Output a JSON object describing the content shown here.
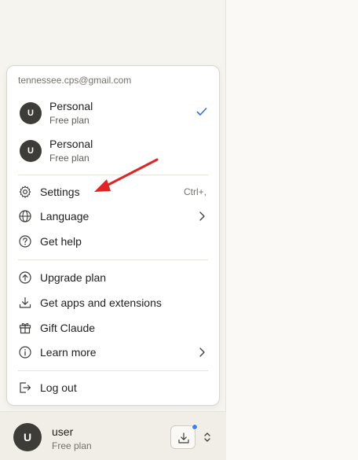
{
  "menu": {
    "email": "tennessee.cps@gmail.com",
    "accounts": [
      {
        "initial": "U",
        "name": "Personal",
        "plan": "Free plan",
        "selected": true
      },
      {
        "initial": "U",
        "name": "Personal",
        "plan": "Free plan",
        "selected": false
      }
    ],
    "items": {
      "settings": {
        "label": "Settings",
        "shortcut": "Ctrl+,",
        "icon": "gear-icon"
      },
      "language": {
        "label": "Language",
        "icon": "globe-icon"
      },
      "help": {
        "label": "Get help",
        "icon": "question-circle-icon"
      },
      "upgrade": {
        "label": "Upgrade plan",
        "icon": "arrow-up-circle-icon"
      },
      "apps": {
        "label": "Get apps and extensions",
        "icon": "download-icon"
      },
      "gift": {
        "label": "Gift Claude",
        "icon": "gift-icon"
      },
      "learn": {
        "label": "Learn more",
        "icon": "info-circle-icon"
      },
      "logout": {
        "label": "Log out",
        "icon": "logout-icon"
      }
    }
  },
  "user": {
    "initial": "U",
    "name": "user",
    "plan": "Free plan"
  },
  "colors": {
    "accent_check": "#2f6fdb",
    "annotation_arrow": "#e02424",
    "notification_dot": "#3b82f6"
  }
}
